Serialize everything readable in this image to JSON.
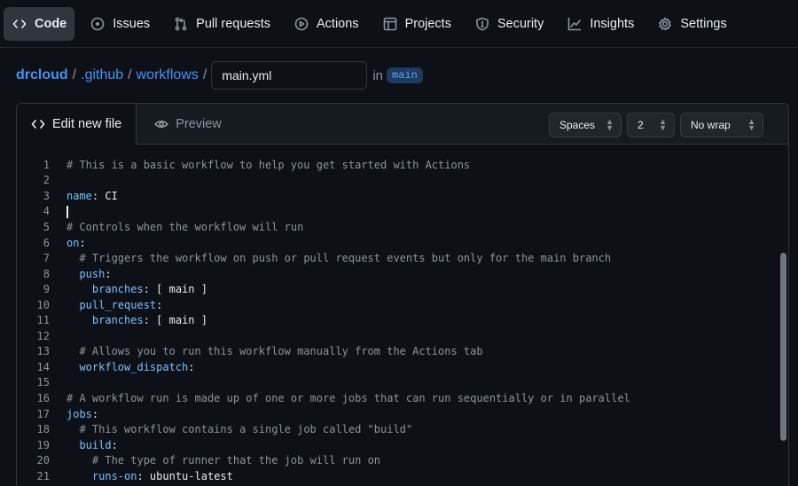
{
  "nav": {
    "tabs": [
      {
        "label": "Code",
        "icon": "code-icon",
        "active": true
      },
      {
        "label": "Issues",
        "icon": "issue-opened-icon"
      },
      {
        "label": "Pull requests",
        "icon": "git-pull-request-icon"
      },
      {
        "label": "Actions",
        "icon": "play-icon"
      },
      {
        "label": "Projects",
        "icon": "table-icon"
      },
      {
        "label": "Security",
        "icon": "shield-icon"
      },
      {
        "label": "Insights",
        "icon": "graph-icon"
      },
      {
        "label": "Settings",
        "icon": "gear-icon"
      }
    ]
  },
  "breadcrumb": {
    "owner": "drcloud",
    "sep": "/",
    "folder1": ".github",
    "folder2": "workflows",
    "filename": "main.yml",
    "in_label": "in",
    "branch": "main"
  },
  "editor": {
    "tab_edit": "Edit new file",
    "tab_preview": "Preview",
    "indent_mode": "Spaces",
    "indent_size": "2",
    "wrap_mode": "No wrap"
  },
  "code_lines": [
    {
      "n": "1",
      "parts": [
        [
          "cmt",
          "# This is a basic workflow to help you get started with Actions"
        ]
      ]
    },
    {
      "n": "2",
      "parts": []
    },
    {
      "n": "3",
      "parts": [
        [
          "key2",
          "name"
        ],
        [
          "val",
          ": CI"
        ]
      ]
    },
    {
      "n": "4",
      "parts": [],
      "cursor": true
    },
    {
      "n": "5",
      "parts": [
        [
          "cmt",
          "# Controls when the workflow will run"
        ]
      ]
    },
    {
      "n": "6",
      "parts": [
        [
          "key2",
          "on"
        ],
        [
          "val",
          ":"
        ]
      ]
    },
    {
      "n": "7",
      "parts": [
        [
          "val",
          "  "
        ],
        [
          "cmt",
          "# Triggers the workflow on push or pull request events but only for the main branch"
        ]
      ]
    },
    {
      "n": "8",
      "parts": [
        [
          "val",
          "  "
        ],
        [
          "key2",
          "push"
        ],
        [
          "val",
          ":"
        ]
      ]
    },
    {
      "n": "9",
      "parts": [
        [
          "val",
          "    "
        ],
        [
          "key2",
          "branches"
        ],
        [
          "val",
          ": [ main ]"
        ]
      ]
    },
    {
      "n": "10",
      "parts": [
        [
          "val",
          "  "
        ],
        [
          "key2",
          "pull_request"
        ],
        [
          "val",
          ":"
        ]
      ]
    },
    {
      "n": "11",
      "parts": [
        [
          "val",
          "    "
        ],
        [
          "key2",
          "branches"
        ],
        [
          "val",
          ": [ main ]"
        ]
      ]
    },
    {
      "n": "12",
      "parts": []
    },
    {
      "n": "13",
      "parts": [
        [
          "val",
          "  "
        ],
        [
          "cmt",
          "# Allows you to run this workflow manually from the Actions tab"
        ]
      ]
    },
    {
      "n": "14",
      "parts": [
        [
          "val",
          "  "
        ],
        [
          "key2",
          "workflow_dispatch"
        ],
        [
          "val",
          ":"
        ]
      ]
    },
    {
      "n": "15",
      "parts": []
    },
    {
      "n": "16",
      "parts": [
        [
          "cmt",
          "# A workflow run is made up of one or more jobs that can run sequentially or in parallel"
        ]
      ]
    },
    {
      "n": "17",
      "parts": [
        [
          "key2",
          "jobs"
        ],
        [
          "val",
          ":"
        ]
      ]
    },
    {
      "n": "18",
      "parts": [
        [
          "val",
          "  "
        ],
        [
          "cmt",
          "# This workflow contains a single job called \"build\""
        ]
      ]
    },
    {
      "n": "19",
      "parts": [
        [
          "val",
          "  "
        ],
        [
          "key2",
          "build"
        ],
        [
          "val",
          ":"
        ]
      ]
    },
    {
      "n": "20",
      "parts": [
        [
          "val",
          "    "
        ],
        [
          "cmt",
          "# The type of runner that the job will run on"
        ]
      ]
    },
    {
      "n": "21",
      "parts": [
        [
          "val",
          "    "
        ],
        [
          "key2",
          "runs-on"
        ],
        [
          "val",
          ": ubuntu-latest"
        ]
      ]
    }
  ]
}
